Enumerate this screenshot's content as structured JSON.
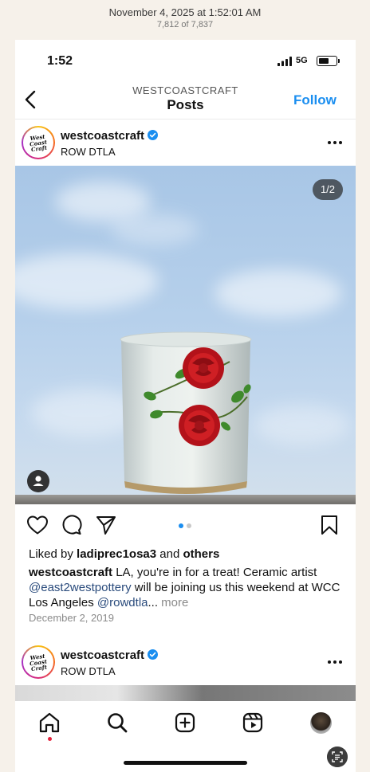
{
  "viewer": {
    "date": "November 4, 2025 at 1:52:01 AM",
    "count": "7,812 of 7,837"
  },
  "status_bar": {
    "time": "1:52",
    "network": "5G",
    "battery_level": 0.6
  },
  "nav": {
    "account": "WESTCOASTCRAFT",
    "title": "Posts",
    "follow_label": "Follow"
  },
  "post": {
    "username": "westcoastcraft",
    "verified": true,
    "location": "ROW DTLA",
    "avatar_logo": [
      "West",
      "Coast",
      "Craft"
    ],
    "image_counter": "1/2",
    "carousel": {
      "count": 2,
      "active": 0
    },
    "likes": {
      "prefix": "Liked by ",
      "user": "ladiprec1osa3",
      "middle": " and ",
      "others": "others"
    },
    "caption": {
      "handle": "westcoastcraft",
      "text_1": " LA, you're in for a treat! Ceramic artist ",
      "mention_1": "@east2westpottery",
      "text_2": " will be joining us this weekend at WCC Los Angeles ",
      "mention_2": "@rowdtla",
      "ellipsis": "...",
      "more": " more"
    },
    "date": "December 2, 2019"
  },
  "next_post": {
    "username": "westcoastcraft",
    "verified": true,
    "location": "ROW DTLA",
    "avatar_logo": [
      "West",
      "Coast",
      "Craft"
    ]
  },
  "colors": {
    "accent": "#1a8ef0",
    "verified": "#1a8ef0",
    "dot_active": "#1a8ef0",
    "dot_inactive": "#c8c8c8",
    "notification": "#e3203a"
  },
  "tab_bar": {
    "items": [
      "home-icon",
      "search-icon",
      "create-icon",
      "reels-icon",
      "profile-avatar"
    ]
  }
}
